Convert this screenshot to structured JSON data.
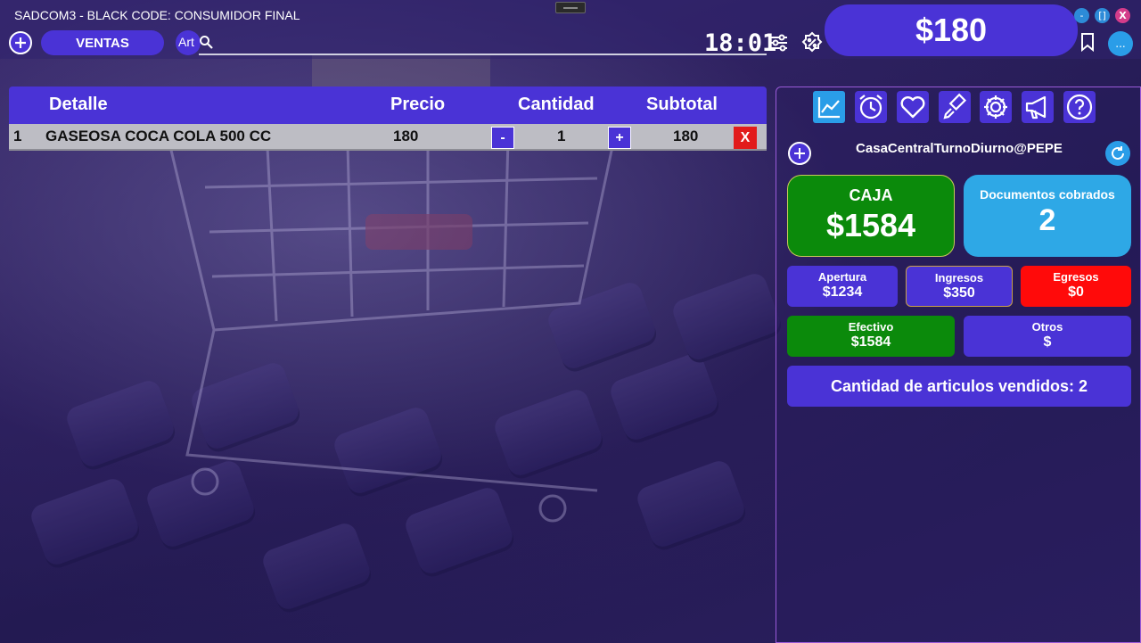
{
  "window": {
    "title": "SADCOM3 - BLACK CODE: CONSUMIDOR FINAL",
    "minimize_label": "-",
    "maximize_label": "[]",
    "close_label": "X"
  },
  "header": {
    "tab_label": "VENTAS",
    "search_label": "Art",
    "search_value": "",
    "clock": "18:01",
    "total": "$180",
    "more_label": "..."
  },
  "table": {
    "columns": [
      "Detalle",
      "Precio",
      "Cantidad",
      "Subtotal"
    ],
    "rows": [
      {
        "index": "1",
        "detail": "GASEOSA COCA COLA 500 CC",
        "price": "180",
        "qty": "1",
        "subtotal": "180",
        "minus_label": "-",
        "plus_label": "+",
        "delete_label": "X"
      }
    ]
  },
  "panel": {
    "session": "CasaCentralTurnoDiurno@PEPE",
    "caja": {
      "label": "CAJA",
      "value": "$1584"
    },
    "documentos": {
      "label": "Documentos cobrados",
      "value": "2"
    },
    "apertura": {
      "label": "Apertura",
      "value": "$1234"
    },
    "ingresos": {
      "label": "Ingresos",
      "value": "$350"
    },
    "egresos": {
      "label": "Egresos",
      "value": "$0"
    },
    "efectivo": {
      "label": "Efectivo",
      "value": "$1584"
    },
    "otros": {
      "label": "Otros",
      "value": "$"
    },
    "articulos": "Cantidad de articulos vendidos: 2",
    "icons": [
      "chart-icon",
      "alarm-clock-icon",
      "heart-icon",
      "brush-icon",
      "settings-icon",
      "megaphone-icon",
      "help-icon"
    ]
  },
  "colors": {
    "accent": "#4a33d6",
    "blue": "#2a9de8",
    "green": "#0b8a0b",
    "red": "#ff0a0a"
  }
}
